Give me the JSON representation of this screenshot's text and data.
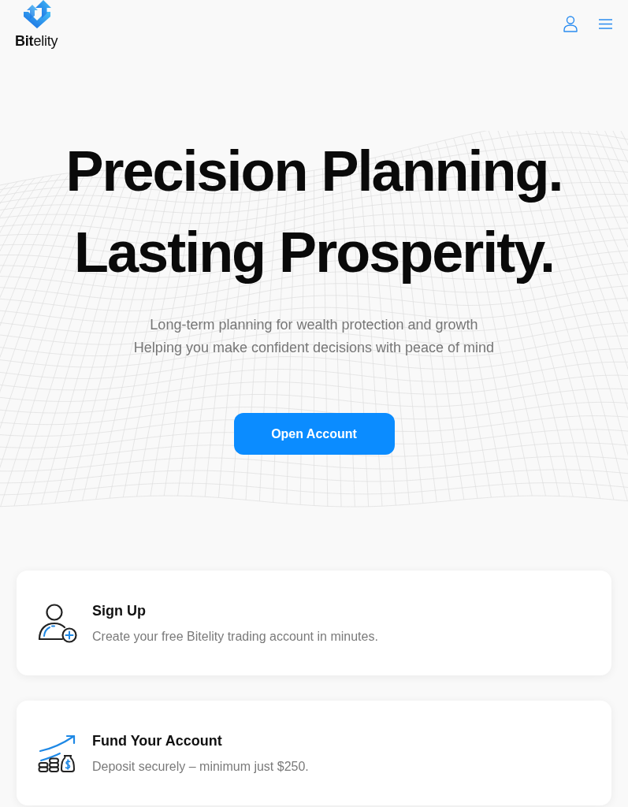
{
  "header": {
    "brand": "**Bit**elity"
  },
  "hero": {
    "headline": [
      "Precision Planning.",
      "Lasting Prosperity."
    ],
    "subtitle": [
      "Long-term planning for wealth protection and growth",
      "Helping you make confident decisions with peace of mind"
    ],
    "cta": "Open Account"
  },
  "steps": [
    {
      "kind": "signup",
      "title": "Sign Up",
      "description": "Create your free Bitelity trading account in minutes."
    },
    {
      "kind": "fund",
      "title": "Fund Your Account",
      "description": "Deposit securely – minimum just $250."
    }
  ]
}
